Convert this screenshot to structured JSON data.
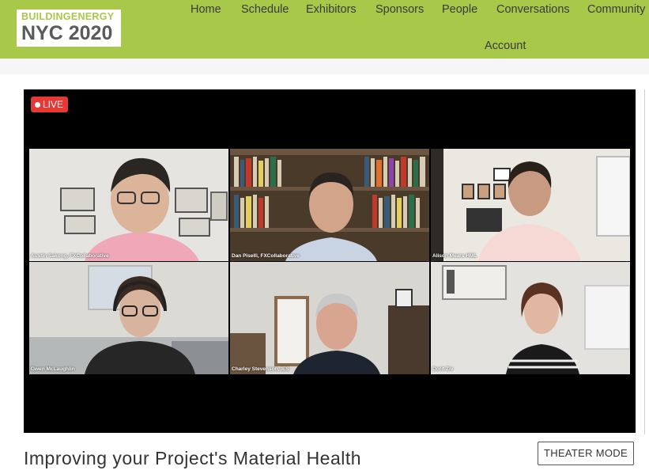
{
  "logo": {
    "line1": "BUILDINGENERGY",
    "line2": "NYC 2020"
  },
  "nav": {
    "items": [
      "Home",
      "Schedule",
      "Exhibitors",
      "Sponsors",
      "People",
      "Conversations",
      "Community"
    ],
    "account": "Account"
  },
  "video": {
    "live_label": "LIVE",
    "participants": [
      "Austin Sakong, FXCollaborative",
      "Dan Piselli, FXCollaborative",
      "Alison Mears HML",
      "Gwen McLaughlin",
      "Charley Stevenson, IES",
      "Dorit Ziv"
    ]
  },
  "session": {
    "title": "Improving your Project's Material Health"
  },
  "buttons": {
    "theater_mode": "THEATER MODE"
  },
  "colors": {
    "header": "#a8c84a",
    "live": "#e53935",
    "logo_accent": "#a8c84a"
  }
}
